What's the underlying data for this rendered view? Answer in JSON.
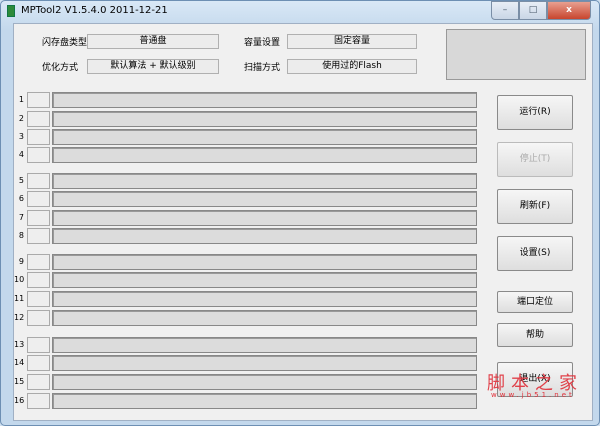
{
  "window": {
    "title": "MPTool2 V1.5.4.0 2011-12-21",
    "min": "–",
    "max": "□",
    "close": "x"
  },
  "settings": {
    "flash_type_label": "闪存盘类型",
    "flash_type_value": "普通盘",
    "capacity_label": "容量设置",
    "capacity_value": "固定容量",
    "optimize_label": "优化方式",
    "optimize_value": "默认算法 + 默认级别",
    "scan_label": "扫描方式",
    "scan_value": "使用过的Flash"
  },
  "ports": [
    "1",
    "2",
    "3",
    "4",
    "5",
    "6",
    "7",
    "8",
    "9",
    "10",
    "11",
    "12",
    "13",
    "14",
    "15",
    "16"
  ],
  "buttons": {
    "run": "运行(R)",
    "stop": "停止(T)",
    "refresh": "刷新(F)",
    "settings": "设置(S)",
    "port_locate": "端口定位",
    "help": "帮助",
    "exit": "退出(X)"
  },
  "watermark": {
    "text": "脚本之家",
    "url": "www.jb51.net"
  }
}
